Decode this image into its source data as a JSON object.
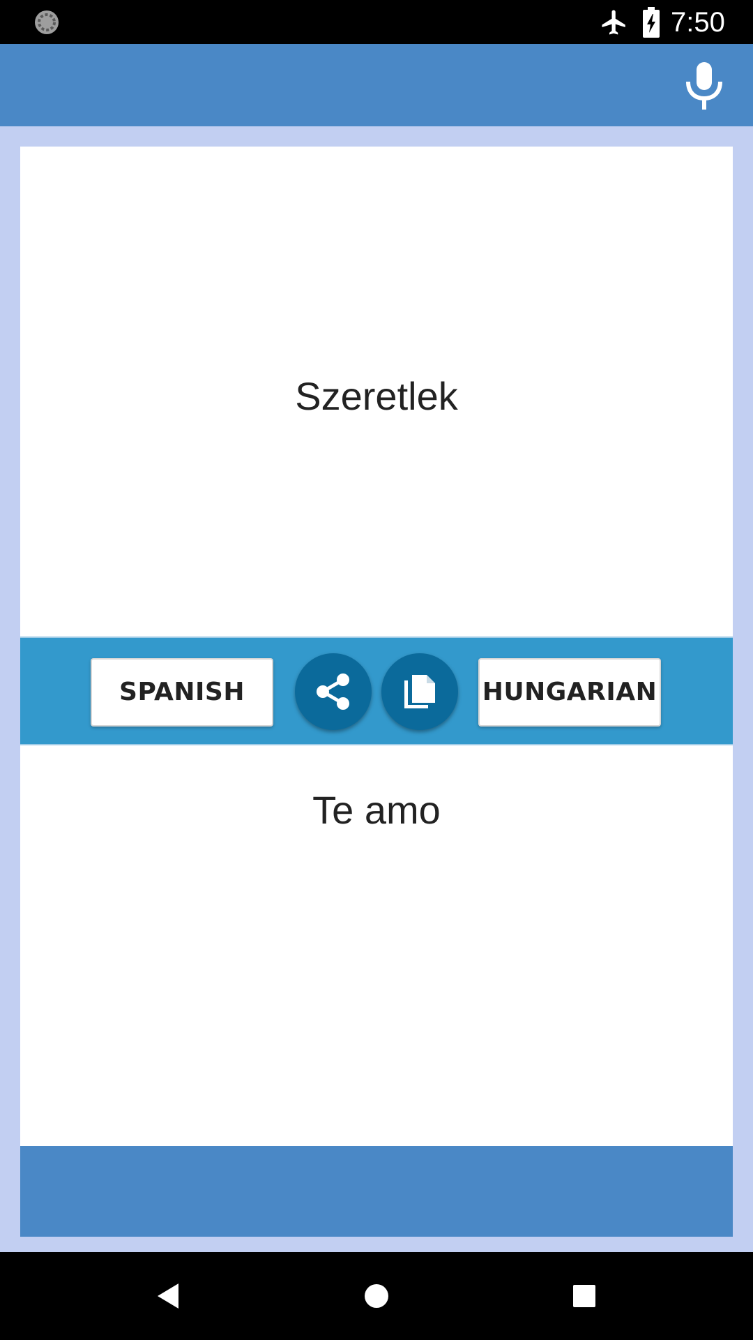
{
  "status_bar": {
    "time": "7:50",
    "icons": [
      "sync-icon",
      "airplane-mode-icon",
      "battery-charging-icon"
    ]
  },
  "app_bar": {
    "mic_icon": "microphone-icon"
  },
  "source": {
    "text": "Szeretlek"
  },
  "toolbar": {
    "source_language": "SPANISH",
    "target_language": "HUNGARIAN",
    "share_icon": "share-icon",
    "copy_icon": "copy-icon"
  },
  "target": {
    "text": "Te amo"
  },
  "nav_bar": {
    "icons": [
      "back-icon",
      "home-icon",
      "recents-icon"
    ]
  },
  "colors": {
    "app_bar": "#4a88c6",
    "background": "#c2cff2",
    "toolbar": "#3399cc",
    "round_button": "#0b6a9b"
  }
}
